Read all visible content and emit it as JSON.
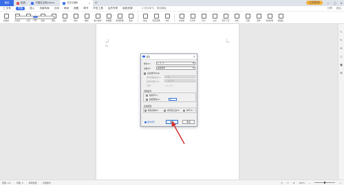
{
  "titlebar": {
    "tabs": [
      {
        "label": "首页"
      },
      {
        "label": "稻壳"
      },
      {
        "label": "中国社交网.docx"
      },
      {
        "label": "文字文稿1"
      }
    ],
    "account_badge": "立即登录"
  },
  "menubar": {
    "items": [
      "三 文件",
      "开始",
      "插入",
      "页面布局",
      "引用",
      "审阅",
      "视图",
      "章节",
      "开发工具",
      "会员专享",
      "稻壳资源"
    ],
    "active_index": 1,
    "search": "Q 查找命令、搜索模板",
    "right": [
      "分享",
      "批注"
    ]
  },
  "ribbon": {
    "groups": [
      {
        "label": "封面页"
      },
      {
        "label": "空白页"
      },
      {
        "label": "分页"
      },
      {
        "label": "表格"
      },
      {
        "label": "图片"
      },
      {
        "label": "截屏"
      },
      {
        "label": "形状"
      },
      {
        "label": "图标"
      },
      {
        "label": "稻壳素材"
      },
      {
        "label": "流程图"
      },
      {
        "label": "思维导图"
      },
      {
        "label": "更多"
      },
      {
        "label": "批注"
      },
      {
        "label": "页眉页脚"
      },
      {
        "label": "页码"
      },
      {
        "label": "水印"
      },
      {
        "label": "文本框"
      },
      {
        "label": "艺术字"
      },
      {
        "label": "符号"
      },
      {
        "label": "公式"
      },
      {
        "label": "首字下沉"
      },
      {
        "label": "对象"
      },
      {
        "label": "日期"
      },
      {
        "label": "附件"
      },
      {
        "label": "文档部件"
      },
      {
        "label": "超链接"
      }
    ]
  },
  "document": {
    "cursor_mark": "Cu"
  },
  "dialog": {
    "title": "页码",
    "style_label": "样式(Y):",
    "style_value": "1, 2, 3...",
    "position_label": "位置(P):",
    "position_value": "底端居中",
    "include_chapter": "包含章节号(N)",
    "chapter_level_label": "章节起始样式(T):",
    "chapter_level_value": "1 级",
    "separator_label": "使用分隔符(S):",
    "separator_value": "- (连字符)",
    "example_label": "示例:",
    "example_value": "1-1, 1-A",
    "numbering_title": "页码编号:",
    "continue_label": "续前节(C)",
    "start_label": "起始页码(A):",
    "start_value": "4",
    "apply_title": "应用范围:",
    "apply_whole": "整篇文档(D)",
    "apply_this": "本页及之后(P)",
    "apply_section": "本节(S)",
    "tips": "操作技巧",
    "ok": "确定",
    "cancel": "取消"
  },
  "statusbar": {
    "page": "页码: 1/1",
    "words": "字数: 0",
    "spell": "拼写检查",
    "doc_check": "文档校对",
    "zoom": "100%",
    "zoom_fraction": 0.5
  },
  "colors": {
    "accent": "#3a6ee8",
    "arrow": "#d62828"
  }
}
